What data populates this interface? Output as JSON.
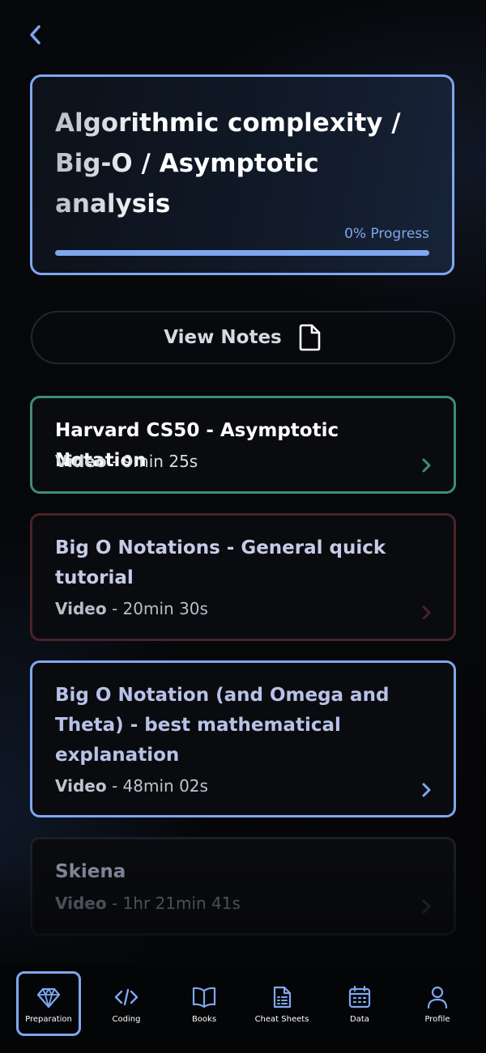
{
  "header": {
    "back_icon": "chevron-left-icon"
  },
  "hero": {
    "title": "Algorithmic complexity / Big-O / Asymptotic analysis",
    "progress_label": "0% Progress",
    "progress_percent": 0
  },
  "notes_button": {
    "label": "View Notes",
    "icon": "document-icon"
  },
  "resources": [
    {
      "title": "Harvard CS50 - Asymptotic Notation",
      "kind": "Video",
      "duration": " - 9min 25s",
      "accent": "#3f8d73"
    },
    {
      "title": "Big O Notations - General quick tutorial",
      "kind": "Video",
      "duration": " - 20min 30s",
      "accent": "#4a2328"
    },
    {
      "title": "Big O Notation (and Omega and Theta) - best mathematical explanation",
      "kind": "Video",
      "duration": " - 48min 02s",
      "accent": "#7fa7ef"
    },
    {
      "title": "Skiena",
      "kind": "Video",
      "duration": " - 1hr 21min 41s",
      "accent": "#1b1e25"
    }
  ],
  "nav": {
    "items": [
      {
        "label": "Preparation",
        "icon": "diamond-icon",
        "active": true
      },
      {
        "label": "Coding",
        "icon": "code-icon",
        "active": false
      },
      {
        "label": "Books",
        "icon": "book-icon",
        "active": false
      },
      {
        "label": "Cheat Sheets",
        "icon": "cheat-sheet-icon",
        "active": false
      },
      {
        "label": "Data",
        "icon": "calendar-icon",
        "active": false
      },
      {
        "label": "Profile",
        "icon": "user-icon",
        "active": false
      }
    ]
  },
  "colors": {
    "accent": "#7fa7ef",
    "background": "#050608"
  }
}
